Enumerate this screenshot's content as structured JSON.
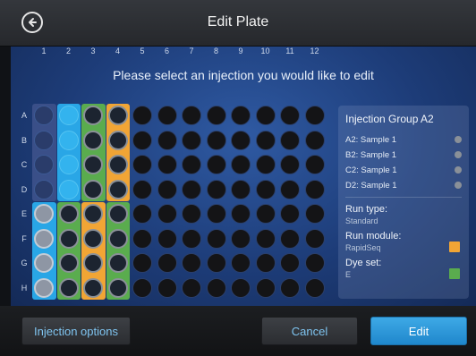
{
  "header": {
    "title": "Edit Plate",
    "back_icon": "back-arrow-icon"
  },
  "prompt": "Please select an injection you would like to edit",
  "plate": {
    "columns": [
      "1",
      "2",
      "3",
      "4",
      "5",
      "6",
      "7",
      "8",
      "9",
      "10",
      "11",
      "12"
    ],
    "rows": [
      "A",
      "B",
      "C",
      "D",
      "E",
      "F",
      "G",
      "H"
    ]
  },
  "info": {
    "title": "Injection Group A2",
    "samples": [
      {
        "label": "A2: Sample 1"
      },
      {
        "label": "B2: Sample 1"
      },
      {
        "label": "C2: Sample 1"
      },
      {
        "label": "D2: Sample 1"
      }
    ],
    "run_type_label": "Run type:",
    "run_type_value": "Standard",
    "run_module_label": "Run module:",
    "run_module_value": "RapidSeq",
    "run_module_color": "#f1a535",
    "dye_set_label": "Dye set:",
    "dye_set_value": "E",
    "dye_set_color": "#5aac4e"
  },
  "footer": {
    "injection_options": "Injection options",
    "cancel": "Cancel",
    "edit": "Edit"
  }
}
